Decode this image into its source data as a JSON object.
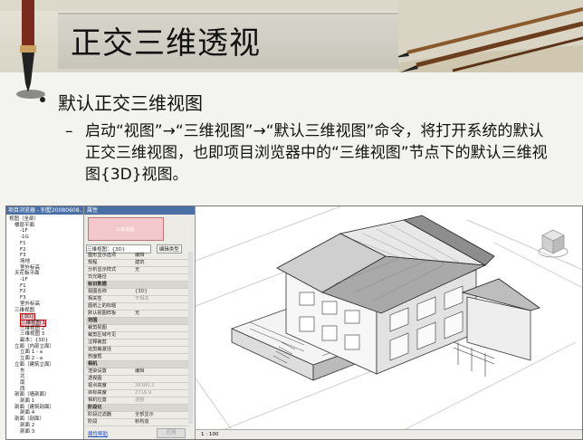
{
  "slide": {
    "title": "正交三维透视",
    "bullet1": "默认正交三维视图",
    "bullet2_dash": "–",
    "bullet2": "启动“视图”→“三维视图”→“默认三维视图”命令，将打开系统的默认正交三维视图，也即项目浏览器中的“三维视图”节点下的默认三维视图{3D}视图。"
  },
  "project_browser": {
    "title": "项目浏览器 - 别墅20080608...",
    "items": [
      {
        "label": "视图（全部）",
        "indent": 0
      },
      {
        "label": "楼层平面",
        "indent": 1
      },
      {
        "label": "-1F",
        "indent": 2
      },
      {
        "label": "-1G",
        "indent": 2
      },
      {
        "label": "F1",
        "indent": 2
      },
      {
        "label": "F2",
        "indent": 2
      },
      {
        "label": "F3",
        "indent": 2
      },
      {
        "label": "场地",
        "indent": 2
      },
      {
        "label": "室外标高",
        "indent": 2
      },
      {
        "label": "天花板平面",
        "indent": 1
      },
      {
        "label": "-1F",
        "indent": 2
      },
      {
        "label": "F1",
        "indent": 2
      },
      {
        "label": "F2",
        "indent": 2
      },
      {
        "label": "F3",
        "indent": 2
      },
      {
        "label": "室外标高",
        "indent": 2
      },
      {
        "label": "三维视图",
        "indent": 1
      },
      {
        "label": "{3D}",
        "indent": 2,
        "selected": true
      },
      {
        "label": "三维视图 1",
        "indent": 2,
        "selected": true
      },
      {
        "label": "三维视图 2",
        "indent": 2
      },
      {
        "label": "三维视图 3",
        "indent": 2
      },
      {
        "label": "副本：{3D}",
        "indent": 2
      },
      {
        "label": "立面（内部立面）",
        "indent": 1
      },
      {
        "label": "立面 1 - a",
        "indent": 2
      },
      {
        "label": "立面 2 - a",
        "indent": 2
      },
      {
        "label": "立面（建筑立面）",
        "indent": 1
      },
      {
        "label": "东",
        "indent": 2
      },
      {
        "label": "北",
        "indent": 2
      },
      {
        "label": "南",
        "indent": 2
      },
      {
        "label": "西",
        "indent": 2
      },
      {
        "label": "剖面（墙剖面）",
        "indent": 1
      },
      {
        "label": "剖面 1",
        "indent": 2
      },
      {
        "label": "剖面（建筑剖面）",
        "indent": 1
      },
      {
        "label": "剖面 4",
        "indent": 2
      },
      {
        "label": "剖面（剖面）",
        "indent": 1
      },
      {
        "label": "剖面 2",
        "indent": 2
      },
      {
        "label": "剖面 3",
        "indent": 2
      }
    ]
  },
  "properties": {
    "title": "属性",
    "preview_label": "三维视图",
    "type_value": "三维视图：{3D}",
    "edit_type": "编辑类型",
    "rows": [
      {
        "k": "图形显示选项",
        "v": "编辑"
      },
      {
        "k": "规程",
        "v": "建筑"
      },
      {
        "k": "分析显示样式",
        "v": "无"
      },
      {
        "k": "日光路径",
        "v": ""
      },
      {
        "k": "标识数据",
        "v": "",
        "group": true
      },
      {
        "k": "视图名称",
        "v": "{3D}"
      },
      {
        "k": "相关性",
        "v": "不相关",
        "gray": true
      },
      {
        "k": "图纸上的标题",
        "v": ""
      },
      {
        "k": "默认视图样板",
        "v": "无"
      },
      {
        "k": "范围",
        "v": "",
        "group": true
      },
      {
        "k": "裁剪视图",
        "v": ""
      },
      {
        "k": "裁剪区域可见",
        "v": ""
      },
      {
        "k": "注释裁剪",
        "v": ""
      },
      {
        "k": "远剪裁激活",
        "v": "",
        "gray": true
      },
      {
        "k": "剖面框",
        "v": ""
      },
      {
        "k": "相机",
        "v": "",
        "group": true
      },
      {
        "k": "渲染设置",
        "v": "编辑"
      },
      {
        "k": "透视图",
        "v": "",
        "gray": true
      },
      {
        "k": "视点高度",
        "v": "26380.2",
        "gray": true
      },
      {
        "k": "目标高度",
        "v": "2716.9",
        "gray": true
      },
      {
        "k": "相机位置",
        "v": "调整",
        "gray": true
      },
      {
        "k": "阶段化",
        "v": "",
        "group": true
      },
      {
        "k": "阶段过滤器",
        "v": "全部显示"
      },
      {
        "k": "阶段",
        "v": "新构造"
      }
    ],
    "help": "属性帮助",
    "apply": "应用"
  },
  "view": {
    "scale": "1 : 100"
  },
  "colors": {
    "accent_blue": "#4a6fa5",
    "selection_pink": "#f4c4cc"
  }
}
